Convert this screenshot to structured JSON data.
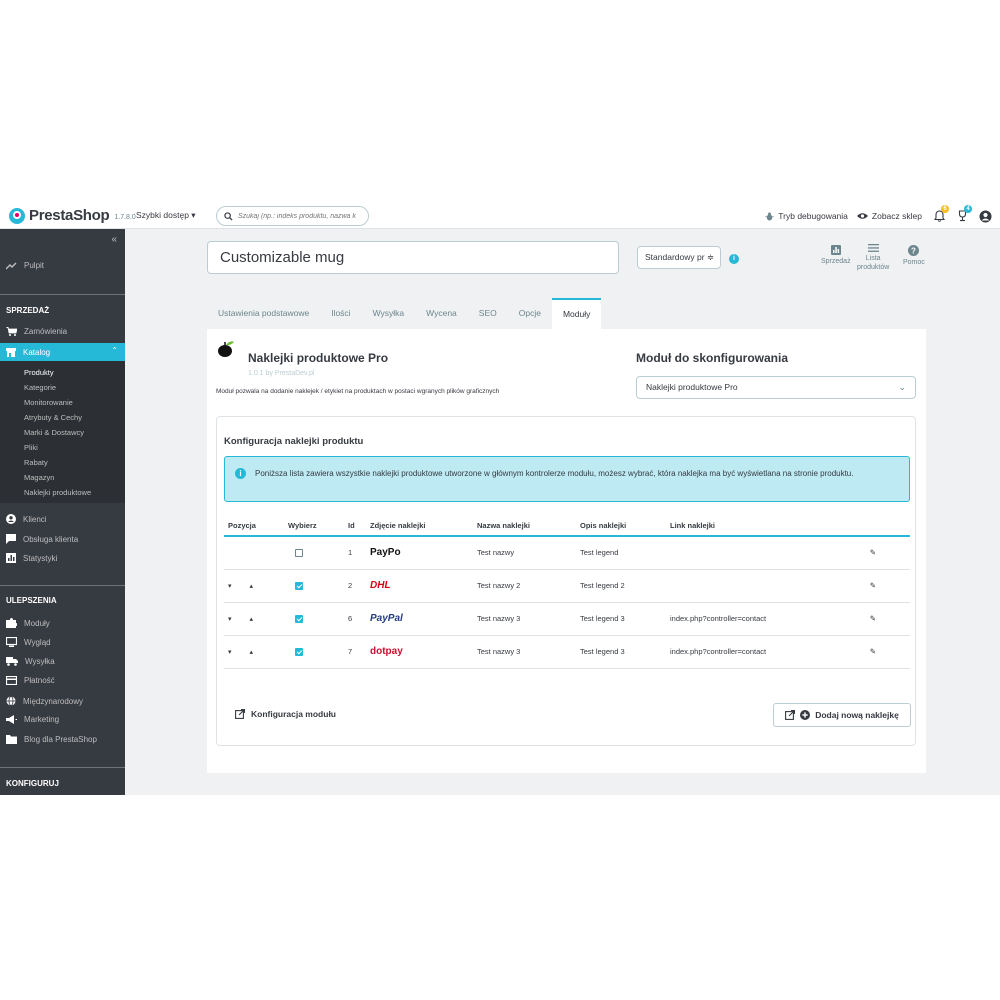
{
  "header": {
    "logo_text": "PrestaShop",
    "version": "1.7.8.0",
    "quick_access": "Szybki dostęp ▾",
    "search_placeholder": "Szukaj (np.: indeks produktu, nazwa k",
    "debug_mode": "Tryb debugowania",
    "view_shop": "Zobacz sklep",
    "notif_count": "6",
    "orders_count": "4"
  },
  "sidebar": {
    "collapse": "«",
    "dashboard": "Pulpit",
    "section_sales": "SPRZEDAŻ",
    "orders": "Zamówienia",
    "catalog": "Katalog",
    "catalog_sub": [
      "Produkty",
      "Kategorie",
      "Monitorowanie",
      "Atrybuty & Cechy",
      "Marki & Dostawcy",
      "Pliki",
      "Rabaty",
      "Magazyn",
      "Naklejki produktowe"
    ],
    "customers": "Klienci",
    "service": "Obsługa klienta",
    "stats": "Statystyki",
    "section_improve": "ULEPSZENIA",
    "modules": "Moduły",
    "design": "Wygląd",
    "shipping": "Wysyłka",
    "payment": "Płatność",
    "international": "Międzynarodowy",
    "marketing": "Marketing",
    "blog": "Blog dla PrestaShop",
    "section_configure": "KONFIGURUJ"
  },
  "product": {
    "name": "Customizable mug",
    "type": "Standardowy pr ≑",
    "info": "i"
  },
  "toolbar": {
    "sales": "Sprzedaż",
    "list_line1": "Lista",
    "list_line2": "produktów",
    "help": "Pomoc"
  },
  "tabs": [
    "Ustawienia podstawowe",
    "Ilości",
    "Wysyłka",
    "Wycena",
    "SEO",
    "Opcje",
    "Moduły"
  ],
  "module": {
    "name": "Naklejki produktowe Pro",
    "version": "1.0.1 by PrestaDev.pl",
    "description": "Moduł pozwala na dodanie naklejek / etykiet na produktach w postaci wgranych plików graficznych",
    "config_title": "Moduł do skonfigurowania",
    "config_value": "Naklejki produktowe Pro",
    "chevron": "⌄"
  },
  "config": {
    "title": "Konfiguracja naklejki produktu",
    "alert_icon": "i",
    "alert": "Poniższa lista zawiera wszystkie naklejki produktowe utworzone w głównym kontrolerze modułu, możesz wybrać, która naklejka ma być wyświetlana na stronie produktu.",
    "columns": [
      "Pozycja",
      "Wybierz",
      "Id",
      "Zdjęcie naklejki",
      "Nazwa naklejki",
      "Opis naklejki",
      "Link naklejki"
    ],
    "arrows": "▾ ▴",
    "edit_icon": "✎",
    "rows": [
      {
        "position": "",
        "checked": false,
        "id": "1",
        "image": "PayPo",
        "image_color": "#111111",
        "name": "Test nazwy",
        "description": "Test legend",
        "link": ""
      },
      {
        "position": "▾ ▴",
        "checked": true,
        "id": "2",
        "image": "DHL",
        "image_color": "#d40511",
        "name": "Test nazwy 2",
        "description": "Test legend 2",
        "link": ""
      },
      {
        "position": "▾ ▴",
        "checked": true,
        "id": "6",
        "image": "PayPal",
        "image_color": "#253b80",
        "name": "Test nazwy 3",
        "description": "Test legend 3",
        "link": "index.php?controller=contact"
      },
      {
        "position": "▾ ▴",
        "checked": true,
        "id": "7",
        "image": "dotpay",
        "image_color": "#c8102e",
        "name": "Test nazwy 3",
        "description": "Test legend 3",
        "link": "index.php?controller=contact"
      }
    ],
    "footer_link": "Konfiguracja modułu",
    "add_button": "Dodaj nową naklejkę"
  },
  "colors": {
    "accent": "#25b9d7",
    "sidebar": "#363a41",
    "text": "#363a41"
  }
}
